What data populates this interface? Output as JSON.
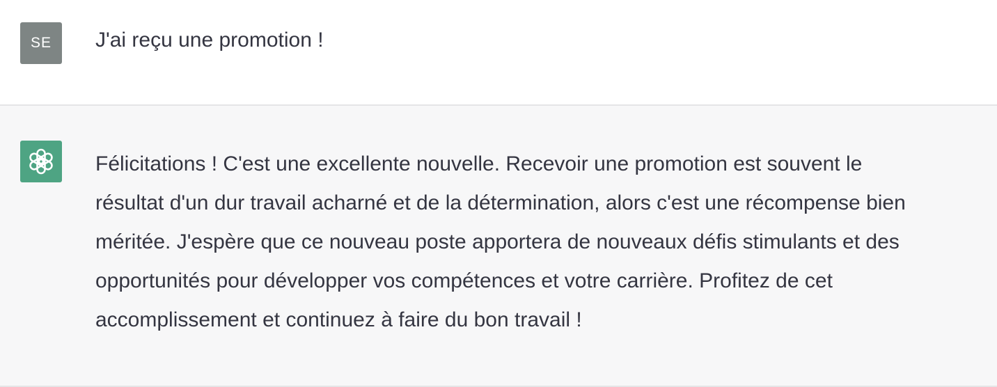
{
  "user_message": {
    "avatar_initials": "SE",
    "avatar_color": "#7e8584",
    "text": "J'ai reçu une promotion !"
  },
  "assistant_message": {
    "avatar_icon": "openai-logo-icon",
    "avatar_color": "#4ea483",
    "lines": [
      "Félicitations ! C'est une excellente nouvelle. Recevoir une promotion est souvent le",
      "résultat d'un dur travail acharné et de la détermination, alors c'est une récompense bien",
      "méritée. J'espère que ce nouveau poste apportera de nouveaux défis stimulants et des",
      "opportunités pour développer vos compétences et votre carrière. Profitez de cet",
      "accomplissement et continuez à faire du bon travail !"
    ]
  }
}
